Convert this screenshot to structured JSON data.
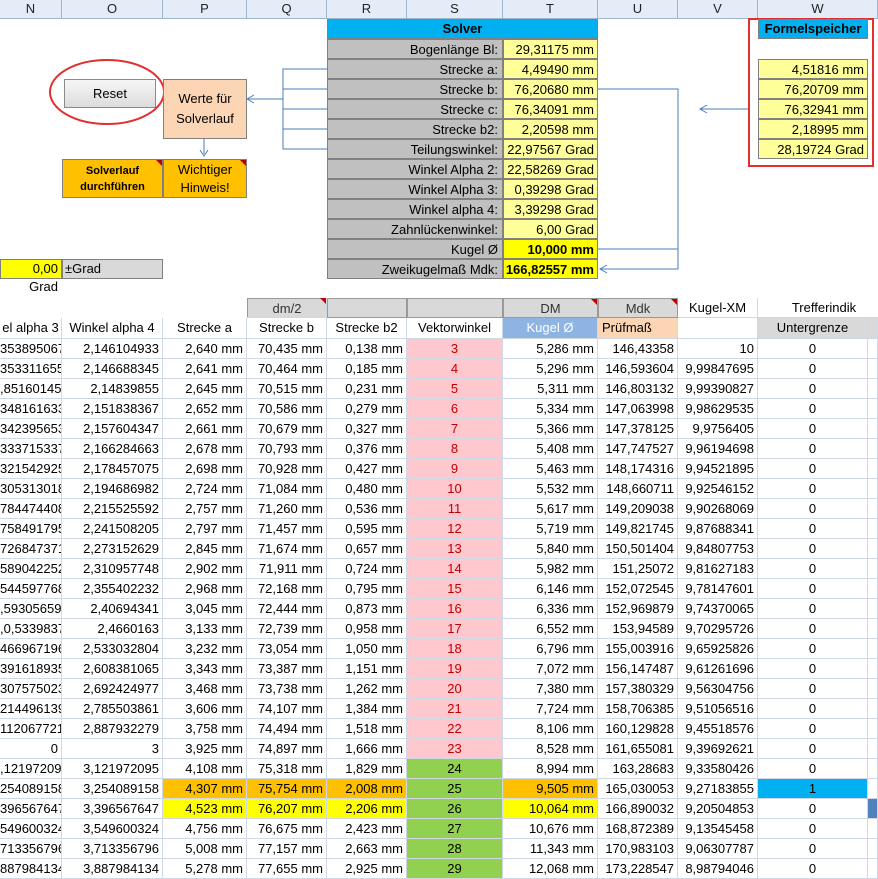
{
  "columns": [
    "N",
    "O",
    "P",
    "Q",
    "R",
    "S",
    "T",
    "U",
    "V",
    "W"
  ],
  "solver": {
    "title": "Solver",
    "rows": [
      {
        "label": "Bogenlänge Bl:",
        "value": "29,31175 mm",
        "bold": false
      },
      {
        "label": "Strecke a:",
        "value": "4,49490 mm",
        "bold": false
      },
      {
        "label": "Strecke b:",
        "value": "76,20680 mm",
        "bold": false
      },
      {
        "label": "Strecke c:",
        "value": "76,34091 mm",
        "bold": false
      },
      {
        "label": "Strecke b2:",
        "value": "2,20598 mm",
        "bold": false
      },
      {
        "label": "Teilungswinkel:",
        "value": "22,97567 Grad",
        "bold": false
      },
      {
        "label": "Winkel Alpha 2:",
        "value": "22,58269 Grad",
        "bold": false
      },
      {
        "label": "Winkel Alpha 3:",
        "value": "0,39298 Grad",
        "bold": false
      },
      {
        "label": "Winkel alpha 4:",
        "value": "3,39298 Grad",
        "bold": false
      },
      {
        "label": "Zahnlückenwinkel:",
        "value": "6,00 Grad",
        "bold": false
      },
      {
        "label": "Kugel Ø",
        "value": "10,000 mm",
        "bold": true
      },
      {
        "label": "Zweikugelmaß Mdk:",
        "value": "166,82557 mm",
        "bold": true
      }
    ]
  },
  "formelspeicher": {
    "title": "Formelspeicher",
    "values": [
      "4,51816 mm",
      "76,20709 mm",
      "76,32941 mm",
      "2,18995 mm",
      "28,19724 Grad"
    ]
  },
  "buttons": {
    "reset": "Reset",
    "werte_line1": "Werte für",
    "werte_line2": "Solverlauf",
    "solverlauf_line1": "Solverlauf",
    "solverlauf_line2": "durchführen",
    "hinweis_line1": "Wichtiger",
    "hinweis_line2": "Hinweis!"
  },
  "grad_row": {
    "value": "0,00 Grad",
    "label": "±Grad"
  },
  "table": {
    "group_headers": {
      "q": "dm/2",
      "t": "DM",
      "u": "Mdk",
      "v": "Kugel-XM",
      "w": "Trefferindik"
    },
    "headers": [
      "el alpha 3",
      "Winkel alpha 4",
      "Strecke a",
      "Strecke b",
      "Strecke b2",
      "Vektorwinkel",
      "Kugel Ø",
      "Prüfmaß",
      "",
      "Untergrenze"
    ],
    "rows": [
      [
        "353895067",
        "2,146104933",
        "2,640 mm",
        "70,435 mm",
        "0,138 mm",
        "3",
        "5,286 mm",
        "146,43358",
        "10",
        "0"
      ],
      [
        "353311655",
        "2,146688345",
        "2,641 mm",
        "70,464 mm",
        "0,185 mm",
        "4",
        "5,296 mm",
        "146,593604",
        "9,99847695",
        "0"
      ],
      [
        ",85160145",
        "2,14839855",
        "2,645 mm",
        "70,515 mm",
        "0,231 mm",
        "5",
        "5,311 mm",
        "146,803132",
        "9,99390827",
        "0"
      ],
      [
        "348161633",
        "2,151838367",
        "2,652 mm",
        "70,586 mm",
        "0,279 mm",
        "6",
        "5,334 mm",
        "147,063998",
        "9,98629535",
        "0"
      ],
      [
        "342395653",
        "2,157604347",
        "2,661 mm",
        "70,679 mm",
        "0,327 mm",
        "7",
        "5,366 mm",
        "147,378125",
        "9,9756405",
        "0"
      ],
      [
        "333715337",
        "2,166284663",
        "2,678 mm",
        "70,793 mm",
        "0,376 mm",
        "8",
        "5,408 mm",
        "147,747527",
        "9,96194698",
        "0"
      ],
      [
        "321542925",
        "2,178457075",
        "2,698 mm",
        "70,928 mm",
        "0,427 mm",
        "9",
        "5,463 mm",
        "148,174316",
        "9,94521895",
        "0"
      ],
      [
        "305313018",
        "2,194686982",
        "2,724 mm",
        "71,084 mm",
        "0,480 mm",
        "10",
        "5,532 mm",
        "148,660711",
        "9,92546152",
        "0"
      ],
      [
        "784474408",
        "2,215525592",
        "2,757 mm",
        "71,260 mm",
        "0,536 mm",
        "11",
        "5,617 mm",
        "149,209038",
        "9,90268069",
        "0"
      ],
      [
        "758491795",
        "2,241508205",
        "2,797 mm",
        "71,457 mm",
        "0,595 mm",
        "12",
        "5,719 mm",
        "149,821745",
        "9,87688341",
        "0"
      ],
      [
        "726847371",
        "2,273152629",
        "2,845 mm",
        "71,674 mm",
        "0,657 mm",
        "13",
        "5,840 mm",
        "150,501404",
        "9,84807753",
        "0"
      ],
      [
        "589042252",
        "2,310957748",
        "2,902 mm",
        "71,911 mm",
        "0,724 mm",
        "14",
        "5,982 mm",
        "151,25072",
        "9,81627183",
        "0"
      ],
      [
        "544597768",
        "2,355402232",
        "2,968 mm",
        "72,168 mm",
        "0,795 mm",
        "15",
        "6,146 mm",
        "152,072545",
        "9,78147601",
        "0"
      ],
      [
        ",59305659",
        "2,40694341",
        "3,045 mm",
        "72,444 mm",
        "0,873 mm",
        "16",
        "6,336 mm",
        "152,969879",
        "9,74370065",
        "0"
      ],
      [
        ",0,5339837",
        "2,4660163",
        "3,133 mm",
        "72,739 mm",
        "0,958 mm",
        "17",
        "6,552 mm",
        "153,94589",
        "9,70295726",
        "0"
      ],
      [
        "466967196",
        "2,533032804",
        "3,232 mm",
        "73,054 mm",
        "1,050 mm",
        "18",
        "6,796 mm",
        "155,003916",
        "9,65925826",
        "0"
      ],
      [
        "391618935",
        "2,608381065",
        "3,343 mm",
        "73,387 mm",
        "1,151 mm",
        "19",
        "7,072 mm",
        "156,147487",
        "9,61261696",
        "0"
      ],
      [
        "307575023",
        "2,692424977",
        "3,468 mm",
        "73,738 mm",
        "1,262 mm",
        "20",
        "7,380 mm",
        "157,380329",
        "9,56304756",
        "0"
      ],
      [
        "214496139",
        "2,785503861",
        "3,606 mm",
        "74,107 mm",
        "1,384 mm",
        "21",
        "7,724 mm",
        "158,706385",
        "9,51056516",
        "0"
      ],
      [
        "112067721",
        "2,887932279",
        "3,758 mm",
        "74,494 mm",
        "1,518 mm",
        "22",
        "8,106 mm",
        "160,129828",
        "9,45518576",
        "0"
      ],
      [
        "0",
        "3",
        "3,925 mm",
        "74,897 mm",
        "1,666 mm",
        "23",
        "8,528 mm",
        "161,655081",
        "9,39692621",
        "0"
      ],
      [
        ",121972095",
        "3,121972095",
        "4,108 mm",
        "75,318 mm",
        "1,829 mm",
        "24",
        "8,994 mm",
        "163,28683",
        "9,33580426",
        "0"
      ],
      [
        "254089158",
        "3,254089158",
        "4,307 mm",
        "75,754 mm",
        "2,008 mm",
        "25",
        "9,505 mm",
        "165,030053",
        "9,27183855",
        "1"
      ],
      [
        "396567647",
        "3,396567647",
        "4,523 mm",
        "76,207 mm",
        "2,206 mm",
        "26",
        "10,064 mm",
        "166,890032",
        "9,20504853",
        "0"
      ],
      [
        "549600324",
        "3,549600324",
        "4,756 mm",
        "76,675 mm",
        "2,423 mm",
        "27",
        "10,676 mm",
        "168,872389",
        "9,13545458",
        "0"
      ],
      [
        "713356796",
        "3,713356796",
        "5,008 mm",
        "77,157 mm",
        "2,663 mm",
        "28",
        "11,343 mm",
        "170,983103",
        "9,06307787",
        "0"
      ],
      [
        "887984134",
        "3,887984134",
        "5,278 mm",
        "77,655 mm",
        "2,925 mm",
        "29",
        "12,068 mm",
        "173,228547",
        "8,98794046",
        "0"
      ]
    ]
  },
  "colors": {
    "solver_title": "#00b0f0",
    "label_gray": "#c0c0c0",
    "value_yellow": "#ffff99",
    "highlight_orange": "#ffc000",
    "highlight_yellow": "#ffff00",
    "pink": "#ffc7ce",
    "green": "#92d050",
    "red_outline": "#e03030"
  }
}
